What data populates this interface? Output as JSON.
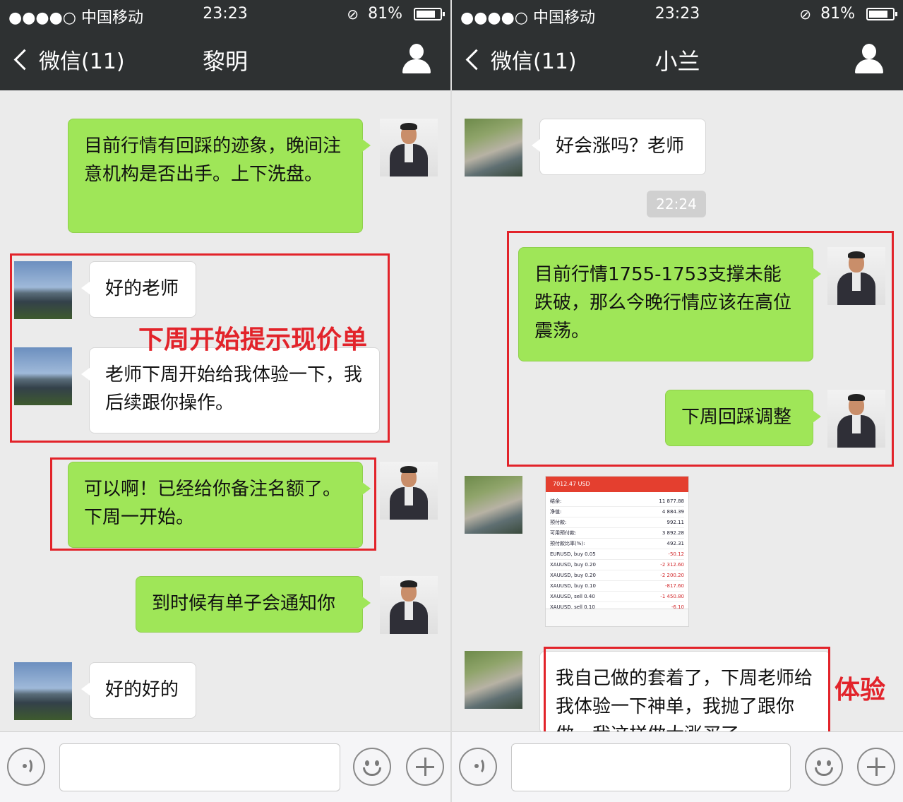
{
  "status": {
    "signal": "●●●●○",
    "carrier": "中国移动",
    "time": "23:23",
    "battery": "81%",
    "battery_level": 0.81
  },
  "left": {
    "back_label": "微信(11)",
    "title": "黎明",
    "messages": [
      {
        "from": "teacher",
        "text": "目前行情有回踩的迹象，晚间注意机构是否出手。上下洗盘。"
      },
      {
        "from": "user",
        "text": "好的老师"
      },
      {
        "from": "user",
        "text": "老师下周开始给我体验一下，我后续跟你操作。"
      },
      {
        "from": "teacher",
        "text": "可以啊！已经给你备注名额了。下周一开始。"
      },
      {
        "from": "teacher",
        "text": "到时候有单子会通知你"
      },
      {
        "from": "user",
        "text": "好的好的"
      }
    ],
    "annotation": "下周开始提示现价单"
  },
  "right": {
    "back_label": "微信(11)",
    "title": "小兰",
    "messages": [
      {
        "from": "user",
        "text": "好会涨吗？老师"
      },
      {
        "from": "teacher",
        "text": "目前行情1755-1753支撑未能跌破，那么今晚行情应该在高位震荡。"
      },
      {
        "from": "teacher",
        "text": "下周回踩调整"
      },
      {
        "from": "user",
        "text": "我自己做的套着了，下周老师给我体验一下神单，我抛了跟你做，我这样做大涨买了"
      }
    ],
    "timestamp": "22:24",
    "annotation": "体验",
    "screenshot": {
      "header": "7012.47 USD",
      "rows": [
        {
          "label": "结余:",
          "value": "11 877.88",
          "neg": false
        },
        {
          "label": "净值:",
          "value": "4 884.39",
          "neg": false
        },
        {
          "label": "预付款:",
          "value": "992.11",
          "neg": false
        },
        {
          "label": "可用预付款:",
          "value": "3 892.28",
          "neg": false
        },
        {
          "label": "预付款比率(%):",
          "value": "492.31",
          "neg": false
        },
        {
          "label": "EURUSD, buy 0.05",
          "value": "-50.12",
          "neg": true
        },
        {
          "label": "XAUUSD, buy 0.20",
          "value": "-2 312.60",
          "neg": true
        },
        {
          "label": "XAUUSD, buy 0.20",
          "value": "-2 200.20",
          "neg": true
        },
        {
          "label": "XAUUSD, buy 0.10",
          "value": "-817.60",
          "neg": true
        },
        {
          "label": "XAUUSD, sell 0.40",
          "value": "-1 450.80",
          "neg": true
        },
        {
          "label": "XAUUSD, sell 0.10",
          "value": "-6.10",
          "neg": true
        }
      ]
    }
  },
  "colors": {
    "nav_bg": "#2e3132",
    "chat_bg": "#ebebeb",
    "bubble_green": "#9fe658",
    "bubble_white": "#ffffff",
    "annotation_red": "#e2232a"
  }
}
